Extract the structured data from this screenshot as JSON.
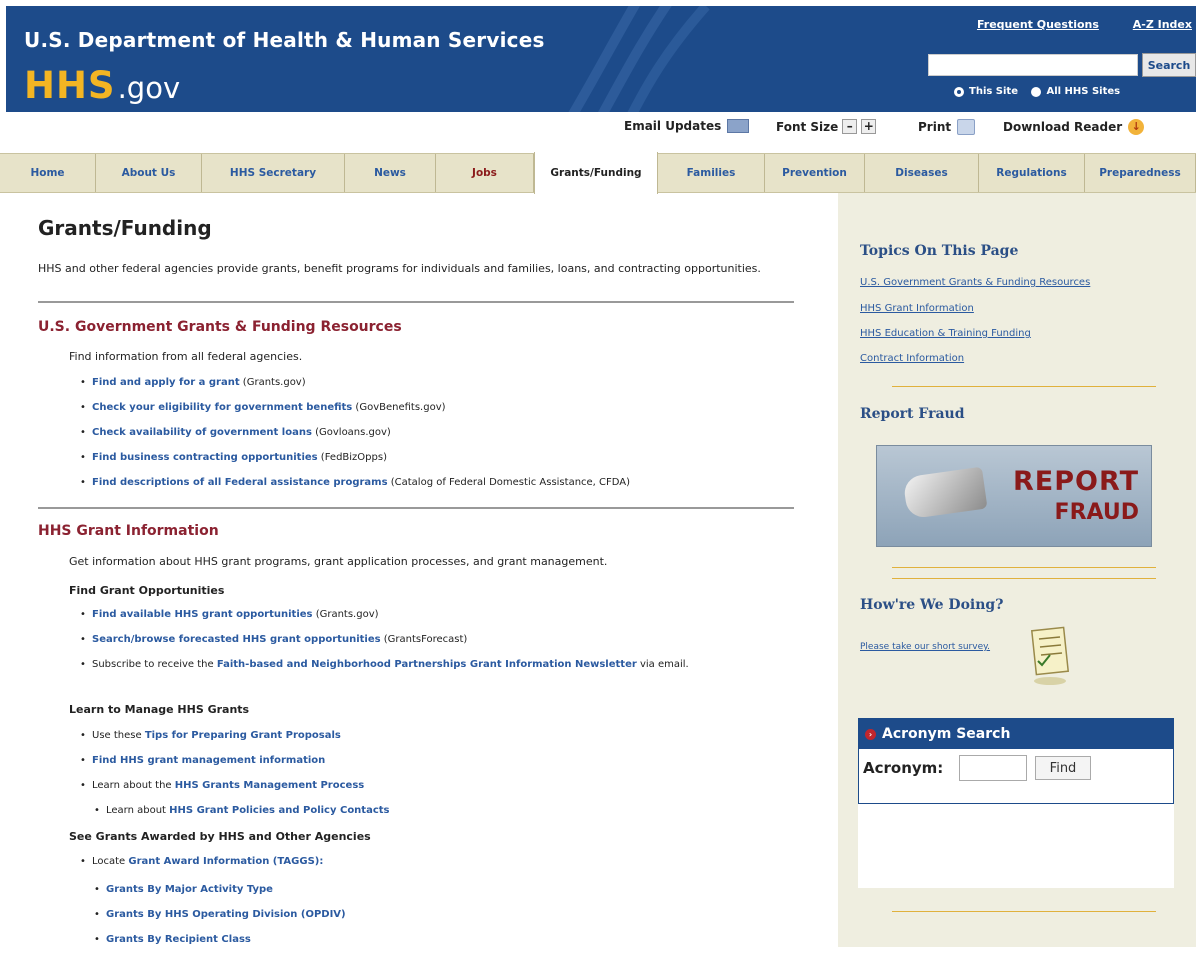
{
  "header": {
    "agency": "U.S. Department of Health & Human Services",
    "logo_main": "HHS",
    "logo_suffix": ".gov",
    "top_links": [
      "Frequent Questions",
      "A-Z Index"
    ],
    "search_value": "",
    "search_button": "Search",
    "scope_options": [
      "This Site",
      "All HHS Sites"
    ],
    "scope_selected": "This Site"
  },
  "utility": {
    "email": "Email Updates",
    "font_size": "Font Size",
    "minus": "–",
    "plus": "+",
    "print": "Print",
    "download": "Download Reader",
    "download_icon": "↓"
  },
  "nav": {
    "tabs": [
      "Home",
      "About Us",
      "HHS Secretary",
      "News",
      "Jobs",
      "Grants/Funding",
      "Families",
      "Prevention",
      "Diseases",
      "Regulations",
      "Preparedness"
    ],
    "active": "Grants/Funding"
  },
  "main": {
    "title": "Grants/Funding",
    "intro": "HHS and other federal agencies provide grants, benefit programs for individuals and families, loans, and contracting opportunities.",
    "sec1": {
      "title": "U.S. Government Grants & Funding Resources",
      "lead": "Find information from all federal agencies.",
      "items": [
        {
          "link": "Find and apply for a grant",
          "note": " (Grants.gov)"
        },
        {
          "link": "Check your eligibility for government benefits",
          "note": " (GovBenefits.gov)"
        },
        {
          "link": "Check availability of government loans",
          "note": " (Govloans.gov)"
        },
        {
          "link": "Find business contracting opportunities",
          "note": " (FedBizOpps)"
        },
        {
          "link": "Find descriptions of all Federal assistance programs",
          "note": " (Catalog of Federal Domestic Assistance, CFDA)"
        }
      ]
    },
    "sec2": {
      "title": "HHS Grant Information",
      "lead": "Get information about HHS grant programs, grant application processes, and grant management.",
      "sub1": {
        "heading": "Find Grant Opportunities",
        "items": [
          {
            "pre": "",
            "link": "Find available HHS grant opportunities",
            "note": " (Grants.gov)"
          },
          {
            "pre": "",
            "link": "Search/browse forecasted HHS grant opportunities",
            "note": " (GrantsForecast)"
          },
          {
            "pre": "Subscribe to receive the ",
            "link": "Faith-based and Neighborhood Partnerships Grant Information Newsletter",
            "note": " via email."
          }
        ]
      },
      "sub2": {
        "heading": "Learn to Manage HHS Grants",
        "items": [
          {
            "pre": "Use these ",
            "link": "Tips for Preparing Grant Proposals",
            "note": ""
          },
          {
            "pre": "",
            "link": "Find HHS grant management information",
            "note": ""
          },
          {
            "pre": "Learn about the ",
            "link": "HHS Grants Management Process",
            "note": ""
          }
        ],
        "nested": {
          "pre": "Learn about ",
          "link": "HHS Grant Policies and Policy Contacts"
        }
      },
      "sub3": {
        "heading": "See Grants Awarded by HHS and Other Agencies",
        "item": {
          "pre": "Locate ",
          "link": "Grant Award Information (TAGGS):"
        },
        "nested": [
          "Grants By Major Activity Type",
          "Grants By HHS Operating Division (OPDIV)",
          "Grants By Recipient Class"
        ]
      }
    }
  },
  "sidebar": {
    "topics_heading": "Topics On This Page",
    "topics": [
      "U.S. Government Grants & Funding Resources",
      "HHS Grant Information",
      "HHS Education & Training Funding",
      "Contract Information"
    ],
    "fraud_heading": "Report Fraud",
    "fraud_line1": "REPORT",
    "fraud_line2": "FRAUD",
    "doing_heading": "How're We Doing?",
    "survey_link": "Please take our short survey.",
    "acronym": {
      "title": "Acronym Search",
      "label": "Acronym:",
      "value": "",
      "button": "Find"
    }
  }
}
